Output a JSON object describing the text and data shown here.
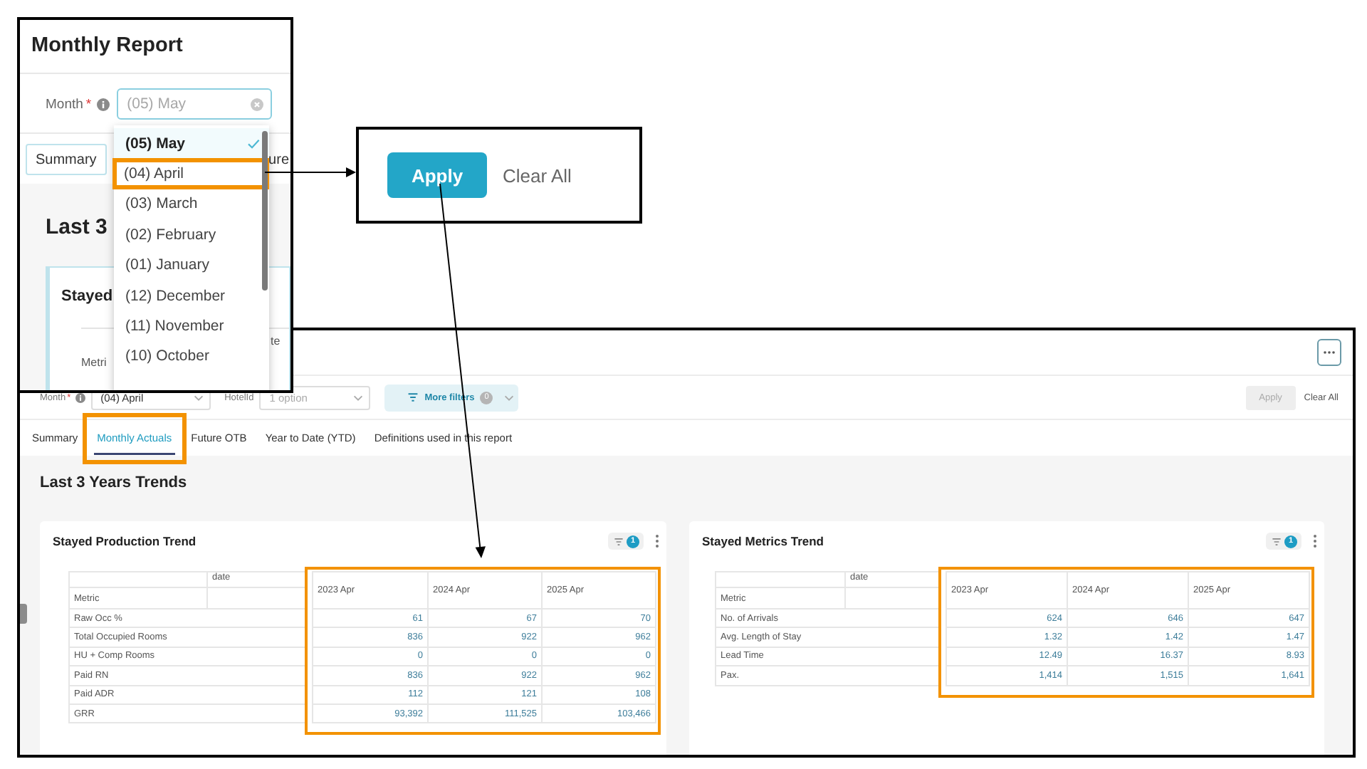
{
  "filter_popup": {
    "title": "Monthly Report",
    "month_field": {
      "label": "Month",
      "required_mark": "*",
      "info": true,
      "placeholder": "(05) May"
    },
    "tabs": [
      {
        "label": "Summary",
        "selected": true
      },
      {
        "label": "ure",
        "selected": false
      }
    ],
    "section_title": "Last 3",
    "card_title": "Stayed",
    "table_header": "te",
    "table_row_header": "Metri",
    "dropdown": [
      {
        "label": "(05) May",
        "selected": true,
        "highlighted": false
      },
      {
        "label": "(04) April",
        "selected": false,
        "highlighted": true
      },
      {
        "label": "(03) March",
        "selected": false,
        "highlighted": false
      },
      {
        "label": "(02) February",
        "selected": false,
        "highlighted": false
      },
      {
        "label": "(01) January",
        "selected": false,
        "highlighted": false
      },
      {
        "label": "(12) December",
        "selected": false,
        "highlighted": false
      },
      {
        "label": "(11) November",
        "selected": false,
        "highlighted": false
      },
      {
        "label": "(10) October",
        "selected": false,
        "highlighted": false
      }
    ]
  },
  "apply_popup": {
    "apply": {
      "label": "Apply",
      "disabled": false
    },
    "clear": "Clear All"
  },
  "report": {
    "filters": [
      {
        "label": "Month",
        "required_mark": "*",
        "info": true,
        "value": "(04) April"
      },
      {
        "label": "HotelId",
        "info": false,
        "placeholder": "1 option"
      }
    ],
    "more_filters": {
      "label": "More filters",
      "count": "0"
    },
    "apply": {
      "label": "Apply",
      "disabled": true
    },
    "clear": "Clear All",
    "tabs": [
      {
        "label": "Summary",
        "selected": false,
        "highlighted": false
      },
      {
        "label": "Monthly Actuals",
        "selected": true,
        "highlighted": true
      },
      {
        "label": "Future OTB",
        "selected": false,
        "highlighted": false
      },
      {
        "label": "Year to Date (YTD)",
        "selected": false,
        "highlighted": false
      },
      {
        "label": "Definitions used in this report",
        "selected": false,
        "highlighted": false
      }
    ],
    "section_title": "Last 3 Years Trends",
    "cards": [
      {
        "title": "Stayed Production Trend",
        "filter_count": "1",
        "corner_header": "date",
        "row_header": "Metric",
        "columns": [
          "2023 Apr",
          "2024 Apr",
          "2025 Apr"
        ],
        "columns_highlighted": true,
        "rows": [
          {
            "metric": "Raw Occ %",
            "values": [
              "61",
              "67",
              "70"
            ]
          },
          {
            "metric": "Total Occupied Rooms",
            "values": [
              "836",
              "922",
              "962"
            ]
          },
          {
            "metric": "HU + Comp Rooms",
            "values": [
              "0",
              "0",
              "0"
            ]
          },
          {
            "metric": "Paid RN",
            "values": [
              "836",
              "922",
              "962"
            ]
          },
          {
            "metric": "Paid ADR",
            "values": [
              "112",
              "121",
              "108"
            ]
          },
          {
            "metric": "GRR",
            "values": [
              "93,392",
              "111,525",
              "103,466"
            ]
          }
        ]
      },
      {
        "title": "Stayed Metrics Trend",
        "filter_count": "1",
        "corner_header": "date",
        "row_header": "Metric",
        "columns": [
          "2023 Apr",
          "2024 Apr",
          "2025 Apr"
        ],
        "columns_highlighted": true,
        "rows": [
          {
            "metric": "No. of Arrivals",
            "values": [
              "624",
              "646",
              "647"
            ]
          },
          {
            "metric": "Avg. Length of Stay",
            "values": [
              "1.32",
              "1.42",
              "1.47"
            ]
          },
          {
            "metric": "Lead Time",
            "values": [
              "12.49",
              "16.37",
              "8.93"
            ]
          },
          {
            "metric": "Pax.",
            "values": [
              "1,414",
              "1,515",
              "1,641"
            ]
          }
        ]
      }
    ]
  }
}
